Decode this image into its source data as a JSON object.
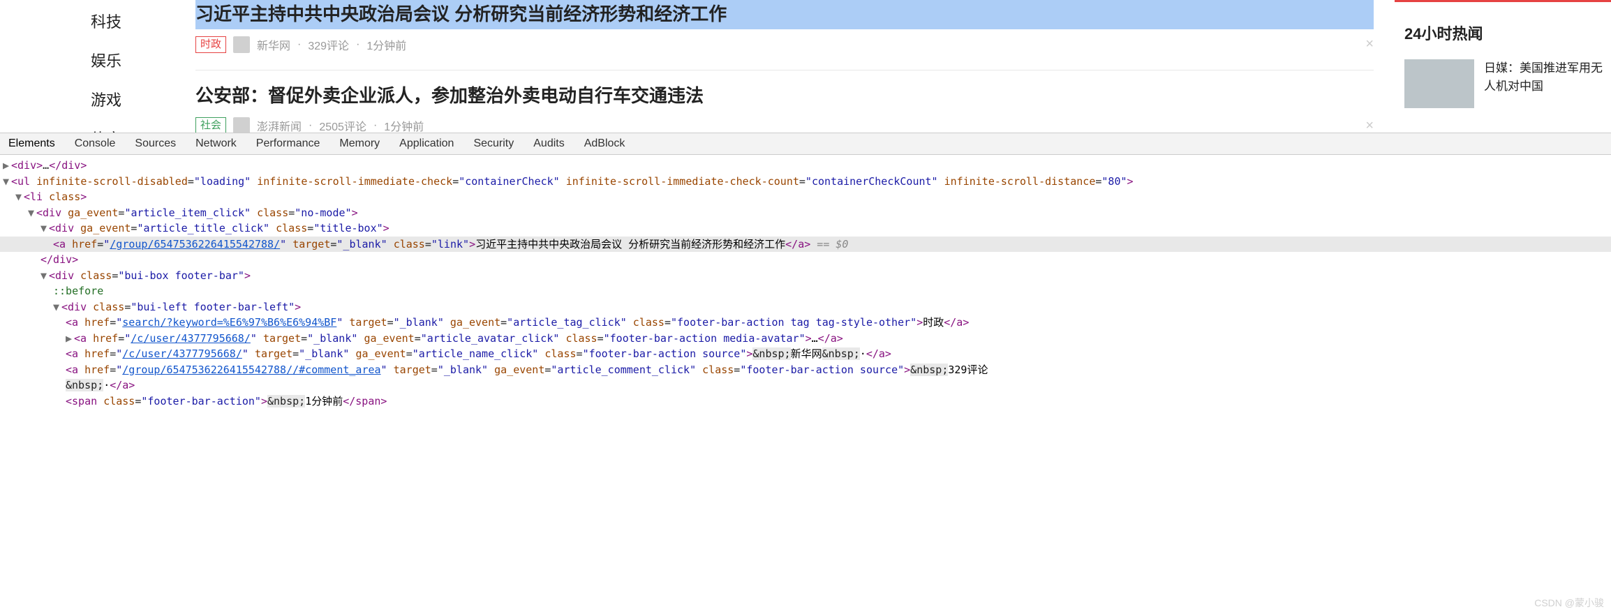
{
  "sidebar": {
    "items": [
      "科技",
      "娱乐",
      "游戏",
      "体育"
    ]
  },
  "feed": {
    "article1": {
      "title": "习近平主持中共中央政治局会议 分析研究当前经济形势和经济工作",
      "tag": "时政",
      "source": "新华网",
      "comments": "329评论",
      "time": "1分钟前",
      "dot": "·"
    },
    "article2": {
      "title": "公安部：督促外卖企业派人，参加整治外卖电动自行车交通违法",
      "tag": "社会",
      "source": "澎湃新闻",
      "comments": "2505评论",
      "time": "1分钟前",
      "dot": "·"
    },
    "close": "×"
  },
  "rightcol": {
    "title": "24小时热闻",
    "item1": "日媒：美国推进军用无人机对中国"
  },
  "devtools": {
    "tabs": [
      "Elements",
      "Console",
      "Sources",
      "Network",
      "Performance",
      "Memory",
      "Application",
      "Security",
      "Audits",
      "AdBlock"
    ],
    "line1": {
      "a": "▶",
      "open": "<div>",
      "dots": "…",
      "close": "</div>"
    },
    "line2": {
      "a": "▼",
      "t": "<ul",
      "a1n": "infinite-scroll-disabled",
      "a1v": "\"loading\"",
      "a2n": "infinite-scroll-immediate-check",
      "a2v": "\"containerCheck\"",
      "a3n": "infinite-scroll-immediate-check-count",
      "a3v": "\"containerCheckCount\"",
      "a4n": "infinite-scroll-distance",
      "a4v": "\"80\"",
      "end": ">"
    },
    "line3": {
      "a": "▼",
      "t": "<li",
      "a1n": "class",
      "end": ">"
    },
    "line4": {
      "a": "▼",
      "t": "<div",
      "a1n": "ga_event",
      "a1v": "\"article_item_click\"",
      "a2n": "class",
      "a2v": "\"no-mode\"",
      "end": ">"
    },
    "line5": {
      "a": "▼",
      "t": "<div",
      "a1n": "ga_event",
      "a1v": "\"article_title_click\"",
      "a2n": "class",
      "a2v": "\"title-box\"",
      "end": ">"
    },
    "line6": {
      "t": "<a",
      "a1n": "href",
      "a1v": "/group/6547536226415542788/",
      "q": "\"",
      "a2n": "target",
      "a2v": "\"_blank\"",
      "a3n": "class",
      "a3v": "\"link\"",
      "end": ">",
      "text": "习近平主持中共中央政治局会议 分析研究当前经济形势和经济工作",
      "close": "</a>",
      "eq": " == $0"
    },
    "line7": {
      "t": "</div>"
    },
    "line8": {
      "a": "▼",
      "t": "<div",
      "a1n": "class",
      "a1v": "\"bui-box footer-bar\"",
      "end": ">"
    },
    "line9": {
      "t": "::before"
    },
    "line10": {
      "a": "▼",
      "t": "<div",
      "a1n": "class",
      "a1v": "\"bui-left footer-bar-left\"",
      "end": ">"
    },
    "line11": {
      "t": "<a",
      "a1n": "href",
      "a1v": "search/?keyword=%E6%97%B6%E6%94%BF",
      "q": "\"",
      "a2n": "target",
      "a2v": "\"_blank\"",
      "a3n": "ga_event",
      "a3v": "\"article_tag_click\"",
      "a4n": "class",
      "a4v": "\"footer-bar-action tag tag-style-other\"",
      "end": ">",
      "text": "时政",
      "close": "</a>"
    },
    "line12": {
      "a": "▶",
      "t": "<a",
      "a1n": "href",
      "a1v": "/c/user/4377795668/",
      "q": "\"",
      "a2n": "target",
      "a2v": "\"_blank\"",
      "a3n": "ga_event",
      "a3v": "\"article_avatar_click\"",
      "a4n": "class",
      "a4v": "\"footer-bar-action media-avatar\"",
      "end": ">",
      "text": "…",
      "close": "</a>"
    },
    "line13": {
      "t": "<a",
      "a1n": "href",
      "a1v": "/c/user/4377795668/",
      "q": "\"",
      "a2n": "target",
      "a2v": "\"_blank\"",
      "a3n": "ga_event",
      "a3v": "\"article_name_click\"",
      "a4n": "class",
      "a4v": "\"footer-bar-action source\"",
      "end": ">",
      "nb": "&nbsp;",
      "text": "新华网",
      "dot": "·",
      "close": "</a>"
    },
    "line14": {
      "t": "<a",
      "a1n": "href",
      "a1v": "/group/6547536226415542788//#comment_area",
      "q": "\"",
      "a2n": "target",
      "a2v": "\"_blank\"",
      "a3n": "ga_event",
      "a3v": "\"article_comment_click\"",
      "a4n": "class",
      "a4v": "\"footer-bar-action source\"",
      "end": ">",
      "nb": "&nbsp;",
      "text": "329评论",
      "dot": "·",
      "close": "</a>"
    },
    "line14b_nb": "&nbsp;",
    "line15": {
      "t": "<span",
      "a1n": "class",
      "a1v": "\"footer-bar-action\"",
      "end": ">",
      "nb": "&nbsp;",
      "text": "1分钟前",
      "close": "</span>"
    }
  },
  "watermark": "CSDN @蒙小骏"
}
